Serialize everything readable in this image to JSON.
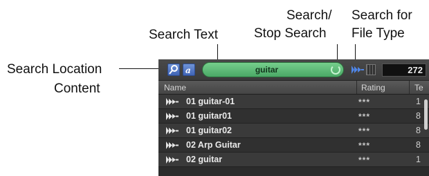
{
  "callouts": {
    "search_text": "Search Text",
    "search_stop_line1": "Search/",
    "search_stop_line2": "Stop Search",
    "file_type_line1": "Search for",
    "file_type_line2": "File Type",
    "location_line1": "Search Location",
    "location_line2": "Content"
  },
  "toolbar": {
    "location_icon": "magnifier-icon",
    "content_icon": "text-icon",
    "search_value": "guitar",
    "refresh_icon": "refresh-icon",
    "file_type_icon": "audio-waveform-icon",
    "view_icon": "grid-icon",
    "result_count": "272"
  },
  "columns": [
    "Name",
    "Rating",
    "Te"
  ],
  "rows": [
    {
      "name": "01 guitar-01",
      "rating": "***",
      "tempo": "1"
    },
    {
      "name": "01 guitar01",
      "rating": "***",
      "tempo": "8"
    },
    {
      "name": "01 guitar02",
      "rating": "***",
      "tempo": "8"
    },
    {
      "name": "02 Arp Guitar",
      "rating": "***",
      "tempo": "8"
    },
    {
      "name": "02 guitar",
      "rating": "***",
      "tempo": "1"
    }
  ],
  "colors": {
    "search_field": "#4aa866",
    "buttons": "#3f64b6",
    "panel_bg": "#2b2b2b"
  }
}
